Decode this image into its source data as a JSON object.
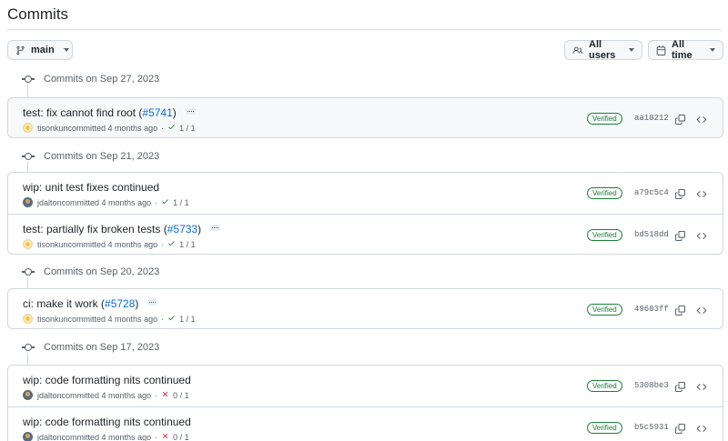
{
  "page": {
    "title": "Commits"
  },
  "filters": {
    "branch": "main",
    "users": "All users",
    "time": "All time"
  },
  "groups": [
    {
      "date": "Commits on Sep 27, 2023",
      "commits": [
        {
          "title": "test: fix cannot find root (",
          "pr": "#5741",
          "title_end": ")",
          "has_more": true,
          "author": "tisonkun",
          "action": "committed 4 months ago",
          "status": "success",
          "checks": "1 / 1",
          "verified": "Verified",
          "sha": "aa18212"
        }
      ]
    },
    {
      "date": "Commits on Sep 21, 2023",
      "commits": [
        {
          "title": "wip: unit test fixes continued",
          "pr": "",
          "title_end": "",
          "has_more": false,
          "author": "jdalton",
          "action": "committed 4 months ago",
          "status": "success",
          "checks": "1 / 1",
          "verified": "Verified",
          "sha": "a79c5c4"
        },
        {
          "title": "test: partially fix broken tests (",
          "pr": "#5733",
          "title_end": ")",
          "has_more": true,
          "author": "tisonkun",
          "action": "committed 4 months ago",
          "status": "success",
          "checks": "1 / 1",
          "verified": "Verified",
          "sha": "bd518dd"
        }
      ]
    },
    {
      "date": "Commits on Sep 20, 2023",
      "commits": [
        {
          "title": "ci: make it work (",
          "pr": "#5728",
          "title_end": ")",
          "has_more": true,
          "author": "tisonkun",
          "action": "committed 4 months ago",
          "status": "success",
          "checks": "1 / 1",
          "verified": "Verified",
          "sha": "49683ff"
        }
      ]
    },
    {
      "date": "Commits on Sep 17, 2023",
      "commits": [
        {
          "title": "wip: code formatting nits continued",
          "pr": "",
          "title_end": "",
          "has_more": false,
          "author": "jdalton",
          "action": "committed 4 months ago",
          "status": "failure",
          "checks": "0 / 1",
          "verified": "Verified",
          "sha": "5308be3"
        },
        {
          "title": "wip: code formatting nits continued",
          "pr": "",
          "title_end": "",
          "has_more": false,
          "author": "jdalton",
          "action": "committed 4 months ago",
          "status": "failure",
          "checks": "0 / 1",
          "verified": "Verified",
          "sha": "b5c5931"
        }
      ]
    }
  ],
  "colors": {
    "success": "#1a7f37",
    "failure": "#cf222e",
    "link": "#0969da"
  }
}
